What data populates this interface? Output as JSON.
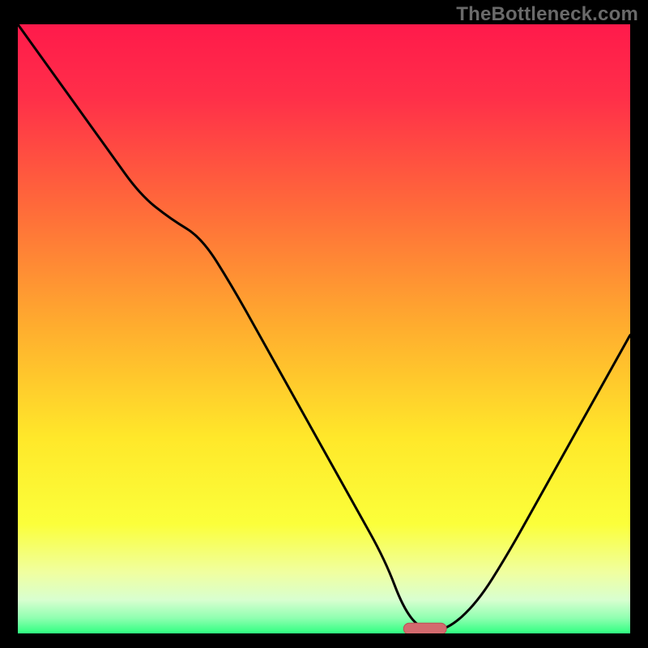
{
  "watermark": "TheBottleneck.com",
  "colors": {
    "gradient_stops": [
      {
        "offset": 0.0,
        "color": "#ff1a4b"
      },
      {
        "offset": 0.12,
        "color": "#ff2f49"
      },
      {
        "offset": 0.3,
        "color": "#ff6a3a"
      },
      {
        "offset": 0.5,
        "color": "#ffae2e"
      },
      {
        "offset": 0.68,
        "color": "#ffe82a"
      },
      {
        "offset": 0.82,
        "color": "#fbff3a"
      },
      {
        "offset": 0.9,
        "color": "#f0ffa0"
      },
      {
        "offset": 0.945,
        "color": "#d8ffd0"
      },
      {
        "offset": 0.975,
        "color": "#8fffb0"
      },
      {
        "offset": 1.0,
        "color": "#2fff80"
      }
    ],
    "curve": "#000000",
    "marker_fill": "#d36a6e",
    "marker_stroke": "#b94f55"
  },
  "chart_data": {
    "type": "line",
    "title": "",
    "xlabel": "",
    "ylabel": "",
    "xlim": [
      0,
      100
    ],
    "ylim": [
      0,
      100
    ],
    "x": [
      0,
      5,
      10,
      15,
      20,
      25,
      30,
      35,
      40,
      45,
      50,
      55,
      60,
      63,
      66,
      70,
      75,
      80,
      85,
      90,
      95,
      100
    ],
    "values": [
      100,
      93,
      86,
      79,
      72,
      68,
      65,
      57,
      48,
      39,
      30,
      21,
      12,
      4,
      0.5,
      0.5,
      5,
      13,
      22,
      31,
      40,
      49
    ],
    "marker": {
      "x_start": 63,
      "x_end": 70,
      "y": 0.5
    }
  }
}
